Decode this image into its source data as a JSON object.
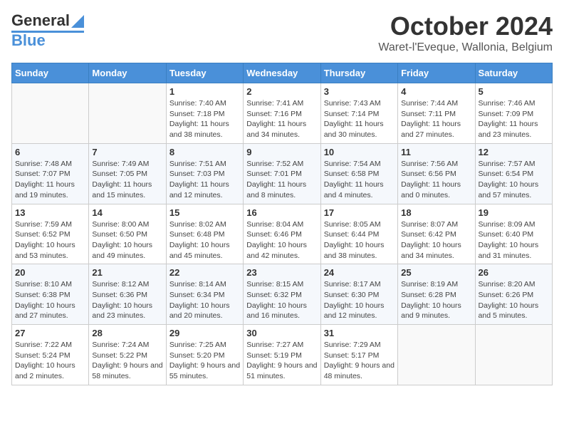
{
  "header": {
    "logo_general": "General",
    "logo_blue": "Blue",
    "month_title": "October 2024",
    "location": "Waret-l'Eveque, Wallonia, Belgium"
  },
  "weekdays": [
    "Sunday",
    "Monday",
    "Tuesday",
    "Wednesday",
    "Thursday",
    "Friday",
    "Saturday"
  ],
  "weeks": [
    [
      {
        "day": "",
        "info": ""
      },
      {
        "day": "",
        "info": ""
      },
      {
        "day": "1",
        "info": "Sunrise: 7:40 AM\nSunset: 7:18 PM\nDaylight: 11 hours and 38 minutes."
      },
      {
        "day": "2",
        "info": "Sunrise: 7:41 AM\nSunset: 7:16 PM\nDaylight: 11 hours and 34 minutes."
      },
      {
        "day": "3",
        "info": "Sunrise: 7:43 AM\nSunset: 7:14 PM\nDaylight: 11 hours and 30 minutes."
      },
      {
        "day": "4",
        "info": "Sunrise: 7:44 AM\nSunset: 7:11 PM\nDaylight: 11 hours and 27 minutes."
      },
      {
        "day": "5",
        "info": "Sunrise: 7:46 AM\nSunset: 7:09 PM\nDaylight: 11 hours and 23 minutes."
      }
    ],
    [
      {
        "day": "6",
        "info": "Sunrise: 7:48 AM\nSunset: 7:07 PM\nDaylight: 11 hours and 19 minutes."
      },
      {
        "day": "7",
        "info": "Sunrise: 7:49 AM\nSunset: 7:05 PM\nDaylight: 11 hours and 15 minutes."
      },
      {
        "day": "8",
        "info": "Sunrise: 7:51 AM\nSunset: 7:03 PM\nDaylight: 11 hours and 12 minutes."
      },
      {
        "day": "9",
        "info": "Sunrise: 7:52 AM\nSunset: 7:01 PM\nDaylight: 11 hours and 8 minutes."
      },
      {
        "day": "10",
        "info": "Sunrise: 7:54 AM\nSunset: 6:58 PM\nDaylight: 11 hours and 4 minutes."
      },
      {
        "day": "11",
        "info": "Sunrise: 7:56 AM\nSunset: 6:56 PM\nDaylight: 11 hours and 0 minutes."
      },
      {
        "day": "12",
        "info": "Sunrise: 7:57 AM\nSunset: 6:54 PM\nDaylight: 10 hours and 57 minutes."
      }
    ],
    [
      {
        "day": "13",
        "info": "Sunrise: 7:59 AM\nSunset: 6:52 PM\nDaylight: 10 hours and 53 minutes."
      },
      {
        "day": "14",
        "info": "Sunrise: 8:00 AM\nSunset: 6:50 PM\nDaylight: 10 hours and 49 minutes."
      },
      {
        "day": "15",
        "info": "Sunrise: 8:02 AM\nSunset: 6:48 PM\nDaylight: 10 hours and 45 minutes."
      },
      {
        "day": "16",
        "info": "Sunrise: 8:04 AM\nSunset: 6:46 PM\nDaylight: 10 hours and 42 minutes."
      },
      {
        "day": "17",
        "info": "Sunrise: 8:05 AM\nSunset: 6:44 PM\nDaylight: 10 hours and 38 minutes."
      },
      {
        "day": "18",
        "info": "Sunrise: 8:07 AM\nSunset: 6:42 PM\nDaylight: 10 hours and 34 minutes."
      },
      {
        "day": "19",
        "info": "Sunrise: 8:09 AM\nSunset: 6:40 PM\nDaylight: 10 hours and 31 minutes."
      }
    ],
    [
      {
        "day": "20",
        "info": "Sunrise: 8:10 AM\nSunset: 6:38 PM\nDaylight: 10 hours and 27 minutes."
      },
      {
        "day": "21",
        "info": "Sunrise: 8:12 AM\nSunset: 6:36 PM\nDaylight: 10 hours and 23 minutes."
      },
      {
        "day": "22",
        "info": "Sunrise: 8:14 AM\nSunset: 6:34 PM\nDaylight: 10 hours and 20 minutes."
      },
      {
        "day": "23",
        "info": "Sunrise: 8:15 AM\nSunset: 6:32 PM\nDaylight: 10 hours and 16 minutes."
      },
      {
        "day": "24",
        "info": "Sunrise: 8:17 AM\nSunset: 6:30 PM\nDaylight: 10 hours and 12 minutes."
      },
      {
        "day": "25",
        "info": "Sunrise: 8:19 AM\nSunset: 6:28 PM\nDaylight: 10 hours and 9 minutes."
      },
      {
        "day": "26",
        "info": "Sunrise: 8:20 AM\nSunset: 6:26 PM\nDaylight: 10 hours and 5 minutes."
      }
    ],
    [
      {
        "day": "27",
        "info": "Sunrise: 7:22 AM\nSunset: 5:24 PM\nDaylight: 10 hours and 2 minutes."
      },
      {
        "day": "28",
        "info": "Sunrise: 7:24 AM\nSunset: 5:22 PM\nDaylight: 9 hours and 58 minutes."
      },
      {
        "day": "29",
        "info": "Sunrise: 7:25 AM\nSunset: 5:20 PM\nDaylight: 9 hours and 55 minutes."
      },
      {
        "day": "30",
        "info": "Sunrise: 7:27 AM\nSunset: 5:19 PM\nDaylight: 9 hours and 51 minutes."
      },
      {
        "day": "31",
        "info": "Sunrise: 7:29 AM\nSunset: 5:17 PM\nDaylight: 9 hours and 48 minutes."
      },
      {
        "day": "",
        "info": ""
      },
      {
        "day": "",
        "info": ""
      }
    ]
  ]
}
